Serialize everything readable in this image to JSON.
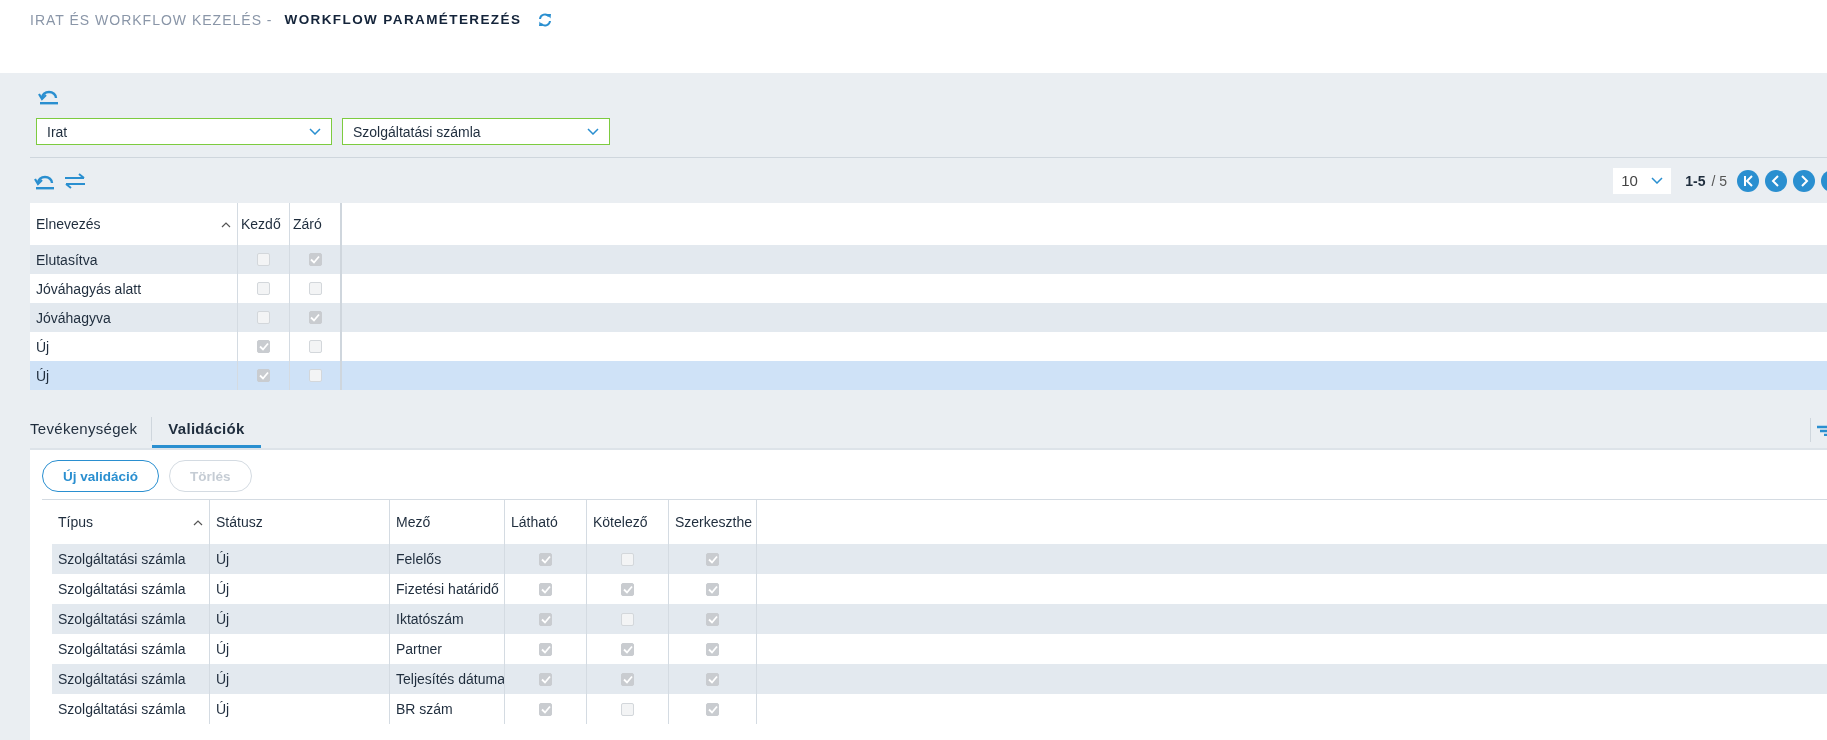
{
  "header": {
    "breadcrumb": "IRAT ÉS WORKFLOW KEZELÉS -",
    "title": "WORKFLOW PARAMÉTEREZÉS"
  },
  "filters": [
    {
      "value": "Irat"
    },
    {
      "value": "Szolgáltatási számla"
    }
  ],
  "pager": {
    "page_size": "10",
    "range": "1-5",
    "total": "/ 5"
  },
  "states_table": {
    "columns": [
      {
        "label": "Elnevezés",
        "sorted": true
      },
      {
        "label": "Kezdő",
        "sorted": false
      },
      {
        "label": "Záró",
        "sorted": false
      }
    ],
    "rows": [
      {
        "name": "Elutasítva",
        "start": false,
        "end": true,
        "selected": false
      },
      {
        "name": "Jóváhagyás alatt",
        "start": false,
        "end": false,
        "selected": false
      },
      {
        "name": "Jóváhagyva",
        "start": false,
        "end": true,
        "selected": false
      },
      {
        "name": "Új",
        "start": true,
        "end": false,
        "selected": false
      },
      {
        "name": "Új",
        "start": true,
        "end": false,
        "selected": true
      }
    ]
  },
  "tabs": [
    {
      "label": "Tevékenységek",
      "selected": false
    },
    {
      "label": "Validációk",
      "selected": true
    }
  ],
  "buttons": [
    {
      "label": "Új validáció",
      "disabled": false
    },
    {
      "label": "Törlés",
      "disabled": true
    }
  ],
  "validations_table": {
    "columns": [
      {
        "label": "Típus",
        "sorted": true
      },
      {
        "label": "Státusz",
        "sorted": false
      },
      {
        "label": "Mező",
        "sorted": false
      },
      {
        "label": "Látható",
        "sorted": false
      },
      {
        "label": "Kötelező",
        "sorted": false
      },
      {
        "label": "Szerkeszthe",
        "sorted": false
      }
    ],
    "rows": [
      {
        "type": "Szolgáltatási számla",
        "status": "Új",
        "field": "Felelős",
        "visible": true,
        "required": false,
        "editable": true
      },
      {
        "type": "Szolgáltatási számla",
        "status": "Új",
        "field": "Fizetési határidő",
        "visible": true,
        "required": true,
        "editable": true
      },
      {
        "type": "Szolgáltatási számla",
        "status": "Új",
        "field": "Iktatószám",
        "visible": true,
        "required": false,
        "editable": true
      },
      {
        "type": "Szolgáltatási számla",
        "status": "Új",
        "field": "Partner",
        "visible": true,
        "required": true,
        "editable": true
      },
      {
        "type": "Szolgáltatási számla",
        "status": "Új",
        "field": "Teljesítés dátuma",
        "visible": true,
        "required": true,
        "editable": true
      },
      {
        "type": "Szolgáltatási számla",
        "status": "Új",
        "field": "BR szám",
        "visible": true,
        "required": false,
        "editable": true
      }
    ]
  }
}
